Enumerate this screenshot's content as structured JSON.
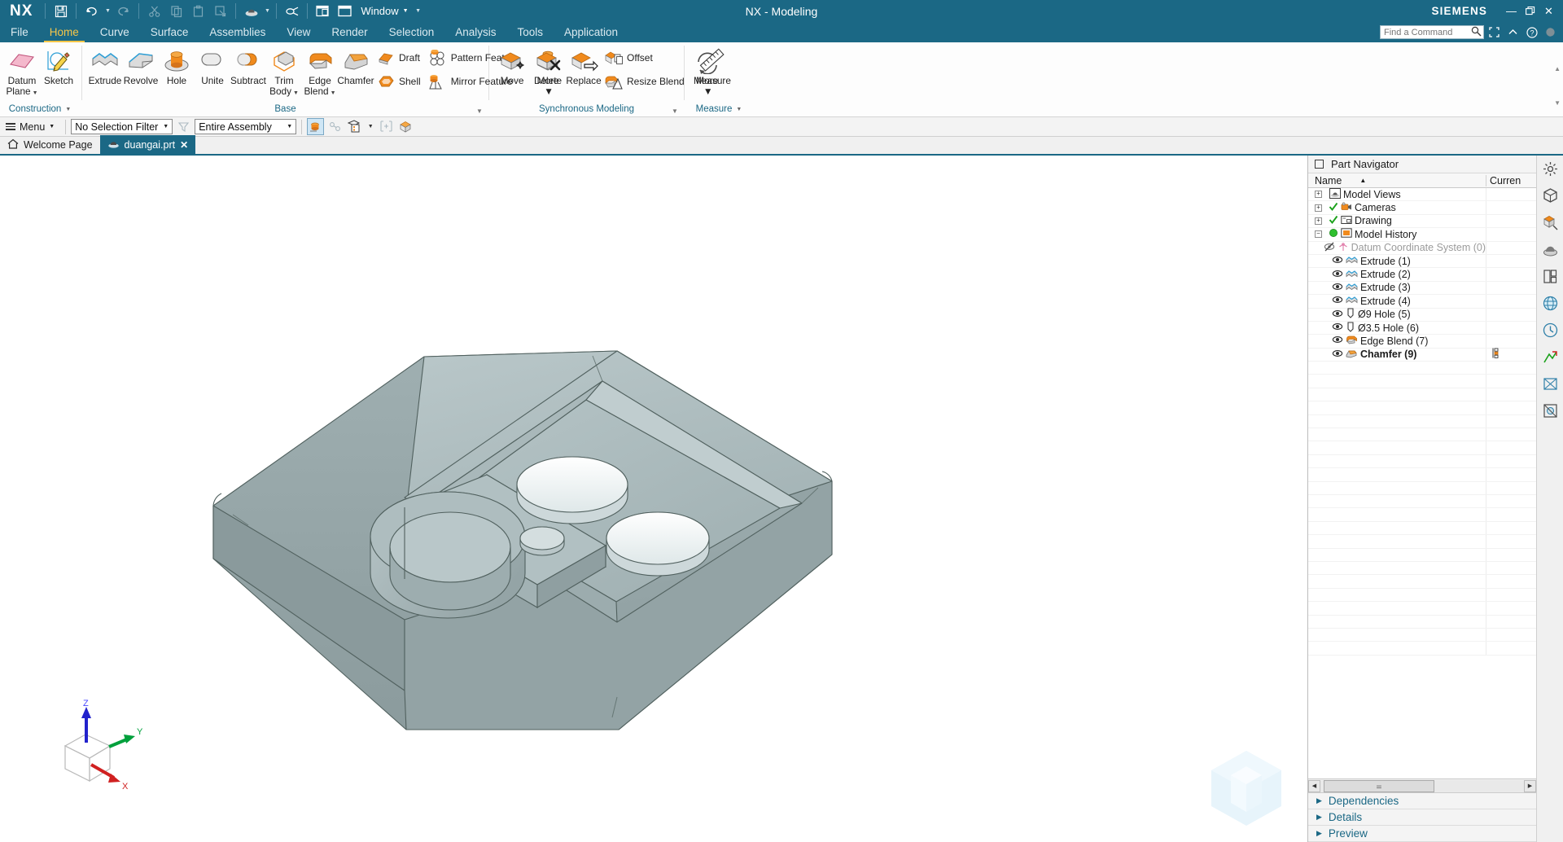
{
  "app": {
    "logo": "NX",
    "title": "NX - Modeling",
    "brand": "SIEMENS",
    "accent_color": "#1b6885",
    "active_tab_color": "#f6c648"
  },
  "quickaccess": {
    "items": [
      {
        "name": "save-icon",
        "tooltip": "Save"
      },
      {
        "name": "undo-icon",
        "tooltip": "Undo"
      },
      {
        "name": "redo-icon",
        "tooltip": "Redo"
      },
      {
        "name": "cut-icon",
        "tooltip": "Cut"
      },
      {
        "name": "copy-icon",
        "tooltip": "Copy"
      },
      {
        "name": "paste-icon",
        "tooltip": "Paste"
      },
      {
        "name": "paste-special-icon",
        "tooltip": "Paste Special"
      },
      {
        "name": "object-display-icon",
        "tooltip": "Edit Object Display"
      },
      {
        "name": "erase-icon",
        "tooltip": "Erase"
      },
      {
        "name": "window-tile-icon",
        "tooltip": "Tile Windows"
      },
      {
        "name": "window-icon",
        "tooltip": "Window"
      }
    ],
    "window_label": "Window"
  },
  "window_controls": {
    "minimize": "—",
    "restore": "❐",
    "close": "✕"
  },
  "menubar": {
    "tabs": [
      {
        "label": "File",
        "active": false
      },
      {
        "label": "Home",
        "active": true
      },
      {
        "label": "Curve",
        "active": false
      },
      {
        "label": "Surface",
        "active": false
      },
      {
        "label": "Assemblies",
        "active": false
      },
      {
        "label": "View",
        "active": false
      },
      {
        "label": "Render",
        "active": false
      },
      {
        "label": "Selection",
        "active": false
      },
      {
        "label": "Analysis",
        "active": false
      },
      {
        "label": "Tools",
        "active": false
      },
      {
        "label": "Application",
        "active": false
      }
    ],
    "search_placeholder": "Find a Command",
    "right_icons": [
      "search-icon",
      "fullscreen-icon",
      "collapse-ribbon-icon",
      "help-icon",
      "account-icon"
    ]
  },
  "ribbon": {
    "groups": [
      {
        "label": "Construction",
        "has_caret": true,
        "big_buttons": [
          {
            "label": "Datum",
            "label2": "Plane",
            "icon": "datum-plane-icon",
            "dropdown": true
          },
          {
            "label": "Sketch",
            "label2": "",
            "icon": "sketch-icon",
            "dropdown": false
          }
        ]
      },
      {
        "label": "Base",
        "has_caret": false,
        "big_buttons": [
          {
            "label": "Extrude",
            "label2": "",
            "icon": "extrude-icon",
            "dropdown": false
          },
          {
            "label": "Revolve",
            "label2": "",
            "icon": "revolve-icon",
            "dropdown": false
          },
          {
            "label": "Hole",
            "label2": "",
            "icon": "hole-icon",
            "dropdown": false
          },
          {
            "label": "Unite",
            "label2": "",
            "icon": "unite-icon",
            "dropdown": false
          },
          {
            "label": "Subtract",
            "label2": "",
            "icon": "subtract-icon",
            "dropdown": false
          },
          {
            "label": "Trim",
            "label2": "Body",
            "icon": "trim-body-icon",
            "dropdown": true
          },
          {
            "label": "Edge",
            "label2": "Blend",
            "icon": "edge-blend-icon",
            "dropdown": true
          },
          {
            "label": "Chamfer",
            "label2": "",
            "icon": "chamfer-icon",
            "dropdown": false
          }
        ],
        "small_columns": [
          [
            {
              "label": "Draft",
              "icon": "draft-icon"
            },
            {
              "label": "Shell",
              "icon": "shell-icon"
            }
          ],
          [
            {
              "label": "Pattern Feature",
              "icon": "pattern-feature-icon"
            },
            {
              "label": "Mirror Feature",
              "icon": "mirror-feature-icon"
            }
          ]
        ],
        "more": {
          "label": "More",
          "icon": "more-base-icon"
        }
      },
      {
        "label": "Synchronous Modeling",
        "has_caret": false,
        "big_buttons": [
          {
            "label": "Move",
            "label2": "",
            "icon": "move-face-icon",
            "dropdown": false
          },
          {
            "label": "Delete",
            "label2": "",
            "icon": "delete-face-icon",
            "dropdown": false
          },
          {
            "label": "Replace",
            "label2": "",
            "icon": "replace-face-icon",
            "dropdown": false
          }
        ],
        "small_columns": [
          [
            {
              "label": "Offset",
              "icon": "offset-region-icon"
            },
            {
              "label": "Resize Blend",
              "icon": "resize-blend-icon"
            }
          ]
        ],
        "more": {
          "label": "More",
          "icon": "more-sync-icon"
        }
      },
      {
        "label": "Measure",
        "has_caret": true,
        "big_buttons": [
          {
            "label": "Measure",
            "label2": "",
            "icon": "measure-icon",
            "dropdown": false
          }
        ]
      }
    ]
  },
  "selection_bar": {
    "menu_label": "Menu",
    "selection_filter": "No Selection Filter",
    "scope": "Entire Assembly",
    "icons": [
      {
        "name": "general-selection-filter-icon",
        "state": "on"
      },
      {
        "name": "snap-point-icon",
        "state": "dim"
      },
      {
        "name": "feature-selection-icon",
        "state": "normal",
        "dropdown": true
      },
      {
        "name": "within-work-part-icon",
        "state": "dim"
      },
      {
        "name": "select-body-icon",
        "state": "normal"
      }
    ]
  },
  "document_tabs": {
    "tabs": [
      {
        "label": "Welcome Page",
        "icon": "home-icon",
        "active": false,
        "closable": false
      },
      {
        "label": "duangai.prt",
        "icon": "part-icon",
        "active": true,
        "closable": true
      }
    ],
    "close_glyph": "✕"
  },
  "part_navigator": {
    "title": "Part Navigator",
    "columns": [
      "Name",
      "Curren"
    ],
    "sort_arrow": "▲",
    "rows": [
      {
        "label": "Model Views",
        "indent": 0,
        "expander": "+",
        "icon": "model-views-icon",
        "check": false,
        "dim": false,
        "bold": false,
        "eye": null,
        "state": ""
      },
      {
        "label": "Cameras",
        "indent": 0,
        "expander": "+",
        "icon": "cameras-icon",
        "check": true,
        "dim": false,
        "bold": false,
        "eye": null,
        "state": ""
      },
      {
        "label": "Drawing",
        "indent": 0,
        "expander": "+",
        "icon": "drawing-icon",
        "check": true,
        "dim": false,
        "bold": false,
        "eye": null,
        "state": ""
      },
      {
        "label": "Model History",
        "indent": 0,
        "expander": "-",
        "icon": "model-history-icon",
        "check": false,
        "green": true,
        "dim": false,
        "bold": false,
        "eye": null,
        "state": ""
      },
      {
        "label": "Datum Coordinate System (0)",
        "indent": 1,
        "expander": "",
        "icon": "datum-csys-icon",
        "dim": true,
        "bold": false,
        "eye": "hidden",
        "state": ""
      },
      {
        "label": "Extrude (1)",
        "indent": 1,
        "expander": "",
        "icon": "extrude-feature-icon",
        "dim": false,
        "bold": false,
        "eye": "visible",
        "state": ""
      },
      {
        "label": "Extrude (2)",
        "indent": 1,
        "expander": "",
        "icon": "extrude-feature-icon",
        "dim": false,
        "bold": false,
        "eye": "visible",
        "state": ""
      },
      {
        "label": "Extrude (3)",
        "indent": 1,
        "expander": "",
        "icon": "extrude-feature-icon",
        "dim": false,
        "bold": false,
        "eye": "visible",
        "state": ""
      },
      {
        "label": "Extrude (4)",
        "indent": 1,
        "expander": "",
        "icon": "extrude-feature-icon",
        "dim": false,
        "bold": false,
        "eye": "visible",
        "state": ""
      },
      {
        "label": "Ø9 Hole (5)",
        "indent": 1,
        "expander": "",
        "icon": "hole-feature-icon",
        "dim": false,
        "bold": false,
        "eye": "visible",
        "state": ""
      },
      {
        "label": "Ø3.5 Hole (6)",
        "indent": 1,
        "expander": "",
        "icon": "hole-feature-icon",
        "dim": false,
        "bold": false,
        "eye": "visible",
        "state": ""
      },
      {
        "label": "Edge Blend (7)",
        "indent": 1,
        "expander": "",
        "icon": "edge-blend-feature-icon",
        "dim": false,
        "bold": false,
        "eye": "visible",
        "state": ""
      },
      {
        "label": "Chamfer (9)",
        "indent": 1,
        "expander": "",
        "icon": "chamfer-feature-icon",
        "dim": false,
        "bold": true,
        "eye": "visible",
        "state": "current-feature-marker"
      }
    ],
    "sections": [
      {
        "label": "Dependencies",
        "expanded": false
      },
      {
        "label": "Details",
        "expanded": false
      },
      {
        "label": "Preview",
        "expanded": false
      }
    ]
  },
  "right_rail": {
    "icons": [
      "assembly-navigator-icon",
      "part-navigator-icon",
      "constraint-navigator-icon",
      "reuse-library-icon",
      "hd3d-tools-icon",
      "web-browser-icon",
      "history-icon",
      "process-studio-icon",
      "roles-icon",
      "system-materials-icon"
    ]
  },
  "viewport": {
    "triad": {
      "z_label": "Z",
      "y_label": "Y",
      "x_label": "X",
      "z_color": "#2222cc",
      "y_color": "#00a03c",
      "x_color": "#d02020"
    },
    "model": {
      "name": "duangai",
      "body_color": "#a8b7b9",
      "edge_color": "#5d6d6f"
    }
  }
}
